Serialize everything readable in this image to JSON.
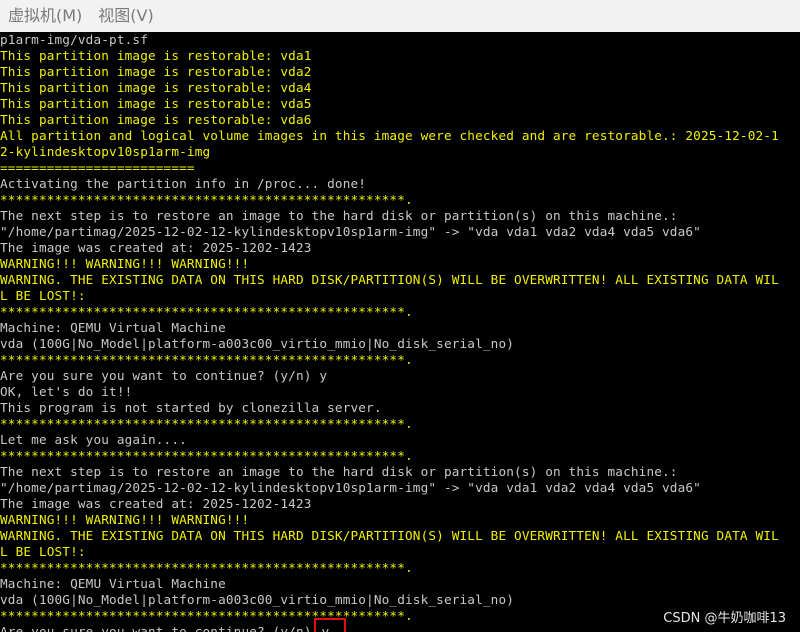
{
  "menubar": {
    "items": [
      "虚拟机(M)",
      "视图(V)"
    ]
  },
  "terminal": {
    "lines": [
      {
        "c": "white",
        "t": "p1arm-img/vda-pt.sf"
      },
      {
        "c": "yellow",
        "t": "This partition image is restorable: vda1"
      },
      {
        "c": "yellow",
        "t": "This partition image is restorable: vda2"
      },
      {
        "c": "yellow",
        "t": "This partition image is restorable: vda4"
      },
      {
        "c": "yellow",
        "t": "This partition image is restorable: vda5"
      },
      {
        "c": "yellow",
        "t": "This partition image is restorable: vda6"
      },
      {
        "c": "yellow",
        "t": "All partition and logical volume images in this image were checked and are restorable.: 2025-12-02-1"
      },
      {
        "c": "yellow",
        "t": "2-kylindesktopv10sp1arm-img"
      },
      {
        "c": "yellow",
        "t": "========================="
      },
      {
        "c": "white",
        "t": "Activating the partition info in /proc... done!"
      },
      {
        "c": "yellow",
        "t": "****************************************************."
      },
      {
        "c": "white",
        "t": "The next step is to restore an image to the hard disk or partition(s) on this machine.:"
      },
      {
        "c": "white",
        "t": "\"/home/partimag/2025-12-02-12-kylindesktopv10sp1arm-img\" -> \"vda vda1 vda2 vda4 vda5 vda6\""
      },
      {
        "c": "white",
        "t": "The image was created at: 2025-1202-1423"
      },
      {
        "c": "yellow",
        "t": "WARNING!!! WARNING!!! WARNING!!!"
      },
      {
        "c": "yellow",
        "t": "WARNING. THE EXISTING DATA ON THIS HARD DISK/PARTITION(S) WILL BE OVERWRITTEN! ALL EXISTING DATA WIL"
      },
      {
        "c": "yellow",
        "t": "L BE LOST!:"
      },
      {
        "c": "yellow",
        "t": "****************************************************."
      },
      {
        "c": "white",
        "t": "Machine: QEMU Virtual Machine"
      },
      {
        "c": "white",
        "t": "vda (100G|No_Model|platform-a003c00_virtio_mmio|No_disk_serial_no)"
      },
      {
        "c": "yellow",
        "t": "****************************************************."
      },
      {
        "c": "white",
        "t": "Are you sure you want to continue? (y/n) y"
      },
      {
        "c": "white",
        "t": "OK, let's do it!!"
      },
      {
        "c": "white",
        "t": "This program is not started by clonezilla server."
      },
      {
        "c": "yellow",
        "t": "****************************************************."
      },
      {
        "c": "white",
        "t": "Let me ask you again...."
      },
      {
        "c": "yellow",
        "t": "****************************************************."
      },
      {
        "c": "white",
        "t": "The next step is to restore an image to the hard disk or partition(s) on this machine.:"
      },
      {
        "c": "white",
        "t": "\"/home/partimag/2025-12-02-12-kylindesktopv10sp1arm-img\" -> \"vda vda1 vda2 vda4 vda5 vda6\""
      },
      {
        "c": "white",
        "t": "The image was created at: 2025-1202-1423"
      },
      {
        "c": "yellow",
        "t": "WARNING!!! WARNING!!! WARNING!!!"
      },
      {
        "c": "yellow",
        "t": "WARNING. THE EXISTING DATA ON THIS HARD DISK/PARTITION(S) WILL BE OVERWRITTEN! ALL EXISTING DATA WIL"
      },
      {
        "c": "yellow",
        "t": "L BE LOST!:"
      },
      {
        "c": "yellow",
        "t": "****************************************************."
      },
      {
        "c": "white",
        "t": "Machine: QEMU Virtual Machine"
      },
      {
        "c": "white",
        "t": "vda (100G|No_Model|platform-a003c00_virtio_mmio|No_disk_serial_no)"
      },
      {
        "c": "yellow",
        "t": "****************************************************."
      }
    ],
    "prompt": "Are you sure you want to continue? (y/n)",
    "input_value": "y"
  },
  "watermark": "CSDN @牛奶咖啡13",
  "colors": {
    "background": "#000000",
    "text_white": "#c8c8c8",
    "text_yellow": "#f0f000",
    "highlight_box": "#e01010"
  }
}
